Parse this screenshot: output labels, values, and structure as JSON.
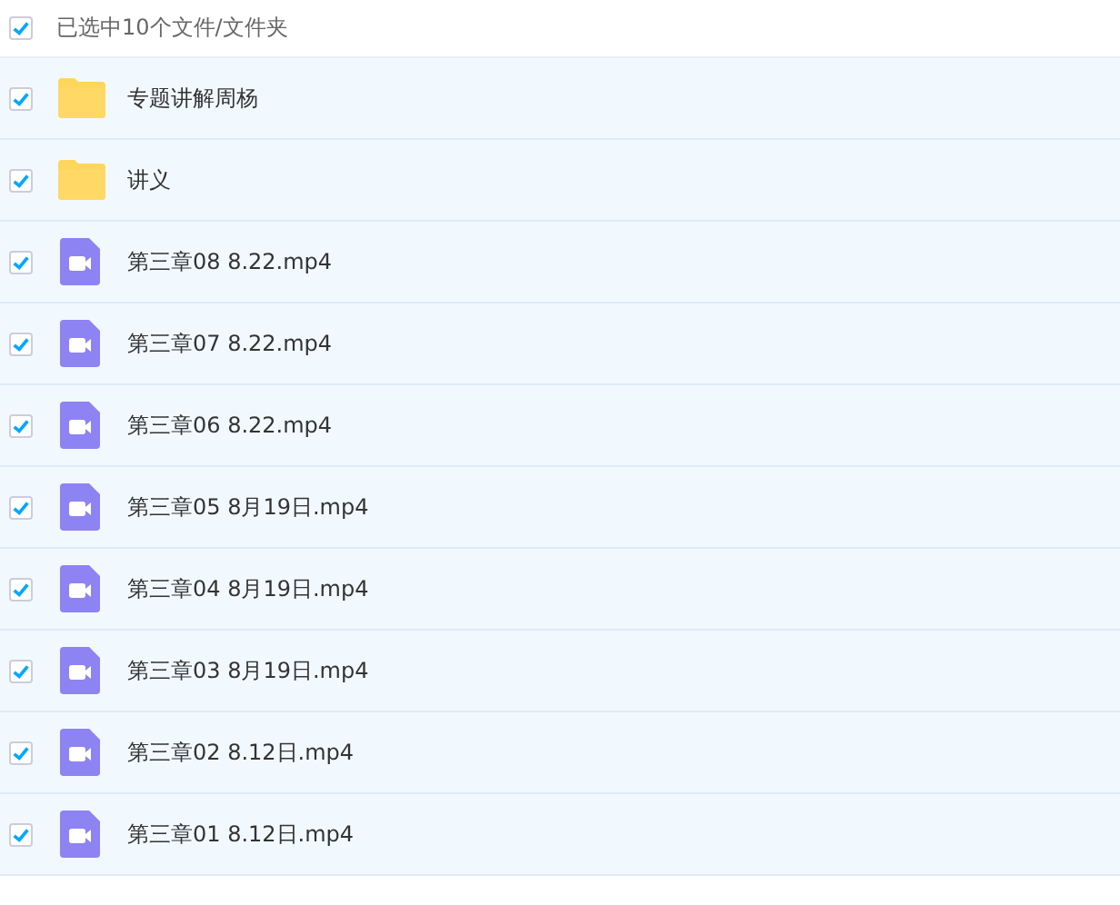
{
  "header": {
    "label": "已选中10个文件/文件夹",
    "checked": true
  },
  "files": [
    {
      "kind": "folder",
      "name": "专题讲解周杨",
      "checked": true
    },
    {
      "kind": "folder",
      "name": "讲义",
      "checked": true
    },
    {
      "kind": "video",
      "name": "第三章08 8.22.mp4",
      "checked": true
    },
    {
      "kind": "video",
      "name": "第三章07 8.22.mp4",
      "checked": true
    },
    {
      "kind": "video",
      "name": "第三章06 8.22.mp4",
      "checked": true
    },
    {
      "kind": "video",
      "name": "第三章05 8月19日.mp4",
      "checked": true
    },
    {
      "kind": "video",
      "name": "第三章04 8月19日.mp4",
      "checked": true
    },
    {
      "kind": "video",
      "name": "第三章03 8月19日.mp4",
      "checked": true
    },
    {
      "kind": "video",
      "name": "第三章02 8.12日.mp4",
      "checked": true
    },
    {
      "kind": "video",
      "name": "第三章01 8.12日.mp4",
      "checked": true
    }
  ]
}
